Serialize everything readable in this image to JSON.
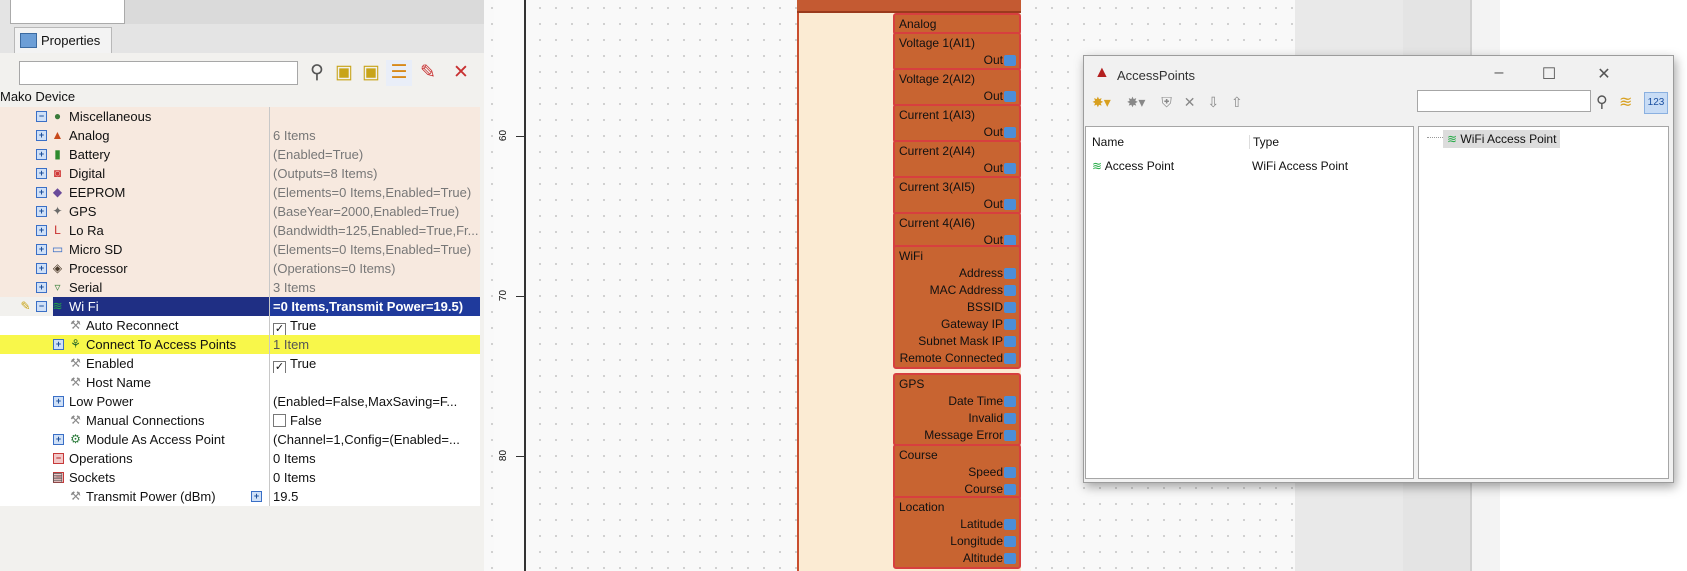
{
  "properties_tab": "Properties",
  "device_label": "Mako Device",
  "toolbar_icons": [
    "filter-icon",
    "folder-icon",
    "folder-icon",
    "tree-view-icon",
    "pin-icon",
    "tools-icon"
  ],
  "tree": [
    {
      "label": "Miscellaneous",
      "value": "",
      "type": "cat",
      "indent": 1,
      "exp": "-",
      "icon": "misc-icon",
      "glyph": "●",
      "color": "#3a7a3a"
    },
    {
      "label": "Analog",
      "value": "6 Items",
      "type": "cat",
      "indent": 1,
      "exp": "+",
      "icon": "analog-icon",
      "glyph": "▲",
      "color": "#c84a1c"
    },
    {
      "label": "Battery",
      "value": "(Enabled=True)",
      "type": "cat",
      "indent": 1,
      "exp": "+",
      "icon": "battery-icon",
      "glyph": "▮",
      "color": "#2e8a2e"
    },
    {
      "label": "Digital",
      "value": "(Outputs=8 Items)",
      "type": "cat",
      "indent": 1,
      "exp": "+",
      "icon": "digital-icon",
      "glyph": "◙",
      "color": "#d13a3a"
    },
    {
      "label": "EEPROM",
      "value": "(Elements=0 Items,Enabled=True)",
      "type": "cat",
      "indent": 1,
      "exp": "+",
      "icon": "eeprom-icon",
      "glyph": "◆",
      "color": "#6a4a9a"
    },
    {
      "label": "GPS",
      "value": "(BaseYear=2000,Enabled=True)",
      "type": "cat",
      "indent": 1,
      "exp": "+",
      "icon": "gps-icon",
      "glyph": "✦",
      "color": "#6a6a6a"
    },
    {
      "label": "Lo Ra",
      "value": "(Bandwidth=125,Enabled=True,Fr...",
      "type": "cat",
      "indent": 1,
      "exp": "+",
      "icon": "lora-icon",
      "glyph": "L",
      "color": "#c83030"
    },
    {
      "label": "Micro SD",
      "value": "(Elements=0 Items,Enabled=True)",
      "type": "cat",
      "indent": 1,
      "exp": "+",
      "icon": "micro-sd-icon",
      "glyph": "▭",
      "color": "#3a6fc6"
    },
    {
      "label": "Processor",
      "value": "(Operations=0 Items)",
      "type": "cat",
      "indent": 1,
      "exp": "+",
      "icon": "processor-icon",
      "glyph": "◈",
      "color": "#4a3a2a"
    },
    {
      "label": "Serial",
      "value": "3 Items",
      "type": "cat",
      "indent": 1,
      "exp": "+",
      "icon": "serial-icon",
      "glyph": "▿",
      "color": "#4a8a4a"
    },
    {
      "label": "Wi Fi",
      "value": "=0 Items,Transmit Power=19.5)",
      "type": "sel",
      "indent": 1,
      "exp": "-",
      "icon": "wifi-icon",
      "glyph": "≋",
      "color": "#22aa44"
    },
    {
      "label": "Auto Reconnect",
      "value": "True",
      "type": "sub",
      "indent": 2,
      "exp": "",
      "icon": "wrench-icon",
      "glyph": "⚒",
      "color": "#888",
      "check": true
    },
    {
      "label": "Connect To Access Points",
      "value": "1 Item",
      "type": "hl",
      "indent": 2,
      "exp": "+",
      "icon": "connect-icon",
      "glyph": "⚘",
      "color": "#2a6a2a"
    },
    {
      "label": "Enabled",
      "value": "True",
      "type": "sub",
      "indent": 2,
      "exp": "",
      "icon": "wrench-icon",
      "glyph": "⚒",
      "color": "#888",
      "check": true
    },
    {
      "label": "Host Name",
      "value": "",
      "type": "sub",
      "indent": 2,
      "exp": "",
      "icon": "wrench-icon",
      "glyph": "⚒",
      "color": "#888"
    },
    {
      "label": "Low Power",
      "value": "(Enabled=False,MaxSaving=F...",
      "type": "subgray",
      "indent": 1.5,
      "exp": "+",
      "icon": "",
      "glyph": "",
      "color": "#888"
    },
    {
      "label": "Manual Connections",
      "value": "False",
      "type": "sub",
      "indent": 2,
      "exp": "",
      "icon": "wrench-icon",
      "glyph": "⚒",
      "color": "#888",
      "check": false
    },
    {
      "label": "Module As Access Point",
      "value": "(Channel=1,Config=(Enabled=...",
      "type": "subgray",
      "indent": 2,
      "exp": "+",
      "icon": "access-point-icon",
      "glyph": "⚙",
      "color": "#2a7a3a"
    },
    {
      "label": "Operations",
      "value": "0 Items",
      "type": "subgray",
      "indent": 1.5,
      "exp": "r",
      "icon": "",
      "glyph": "",
      "color": "#888"
    },
    {
      "label": "Sockets",
      "value": "0 Items",
      "type": "subgray",
      "indent": 1.5,
      "exp": "r",
      "icon": "sockets-icon",
      "glyph": "▤",
      "color": "#555"
    },
    {
      "label": "Transmit Power (dBm)",
      "value": "19.5",
      "type": "sub",
      "indent": 2,
      "exp": "",
      "icon": "wrench-icon",
      "glyph": "⚒",
      "color": "#888",
      "valexp": true
    }
  ],
  "ruler_labels": [
    "60",
    "70",
    "80"
  ],
  "blocks": [
    {
      "title": "Analog",
      "pins": []
    },
    {
      "title": "Voltage 1(AI1)",
      "pins": [
        "Out"
      ]
    },
    {
      "title": "Voltage 2(AI2)",
      "pins": [
        "Out"
      ]
    },
    {
      "title": "Current 1(AI3)",
      "pins": [
        "Out"
      ]
    },
    {
      "title": "Current 2(AI4)",
      "pins": [
        "Out"
      ]
    },
    {
      "title": "Current 3(AI5)",
      "pins": [
        "Out"
      ]
    },
    {
      "title": "Current 4(AI6)",
      "pins": [
        "Out"
      ]
    }
  ],
  "wifi_block": {
    "title": "WiFi",
    "pins": [
      "Address",
      "MAC Address",
      "BSSID",
      "Gateway IP",
      "Subnet Mask IP",
      "Remote Connected"
    ]
  },
  "gps_block": {
    "title": "GPS",
    "pins": [
      "Date Time",
      "Invalid",
      "Message Error"
    ]
  },
  "course_block": {
    "title": "Course",
    "pins": [
      "Speed",
      "Course"
    ]
  },
  "location_block": {
    "title": "Location",
    "pins": [
      "Latitude",
      "Longitude",
      "Altitude"
    ]
  },
  "dialog": {
    "title": "AccessPoints",
    "columns": [
      "Name",
      "Type"
    ],
    "rows": [
      {
        "name": "Access Point",
        "type": "WiFi Access Point"
      }
    ],
    "tree_item": "WiFi Access Point",
    "toolbar_badge": "123"
  }
}
